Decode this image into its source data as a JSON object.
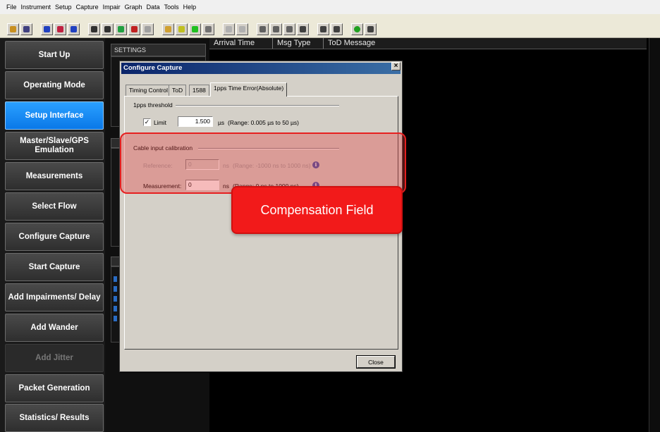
{
  "menu": [
    "File",
    "Instrument",
    "Setup",
    "Capture",
    "Impair",
    "Graph",
    "Data",
    "Tools",
    "Help"
  ],
  "sidebar": {
    "items": [
      {
        "label": "Start Up",
        "state": "normal"
      },
      {
        "label": "Operating Mode",
        "state": "normal"
      },
      {
        "label": "Setup Interface",
        "state": "active"
      },
      {
        "label": "Master/Slave/GPS Emulation",
        "state": "normal"
      },
      {
        "label": "Measurements",
        "state": "normal"
      },
      {
        "label": "Select Flow",
        "state": "normal"
      },
      {
        "label": "Configure Capture",
        "state": "normal"
      },
      {
        "label": "Start Capture",
        "state": "normal"
      },
      {
        "label": "Add Impairments/ Delay",
        "state": "normal"
      },
      {
        "label": "Add Wander",
        "state": "normal"
      },
      {
        "label": "Add Jitter",
        "state": "disabled"
      },
      {
        "label": "Packet Generation",
        "state": "normal"
      },
      {
        "label": "Statistics/ Results",
        "state": "normal"
      }
    ]
  },
  "settings_panel": {
    "title": "SETTINGS"
  },
  "message_table": {
    "columns": [
      "Arrival Time",
      "Msg Type",
      "ToD Message"
    ]
  },
  "dialog": {
    "title": "Configure Capture",
    "close_glyph": "×",
    "tabs": [
      "Timing Control",
      "ToD",
      "1588",
      "1pps Time Error(Absolute)"
    ],
    "active_tab": 3,
    "threshold_group": "1pps threshold",
    "limit": {
      "label": "Limit",
      "checked": true,
      "check_glyph": "✓",
      "value": "1.500",
      "unit": "µs",
      "range": "(Range: 0.005 µs to 50 µs)"
    },
    "cable_group": "Cable input calibration",
    "reference": {
      "label": "Reference:",
      "value": "0",
      "unit": "ns",
      "range": "(Range: -1000 ns to 1000 ns)",
      "enabled": false
    },
    "measurement": {
      "label": "Measurement:",
      "value": "0",
      "unit": "ns",
      "range": "(Range: 0 ns to 1000 ns)",
      "enabled": true
    },
    "info_glyph": "i",
    "close_button": "Close"
  },
  "annotation": {
    "callout_text": "Compensation Field",
    "color": "#f21a1a"
  },
  "toolbar_icons": [
    "open-icon",
    "save-icon",
    "connect-icon",
    "connect-icon",
    "connect-icon",
    "capture-icon",
    "capture-icon",
    "capture-icon",
    "capture-icon",
    "report-icon",
    "graph-icon",
    "capture-start-icon",
    "capture-c-icon",
    "stop-icon",
    "rewind-icon",
    "forward-icon",
    "grid-icon",
    "wave-icon",
    "list-icon",
    "block-icon",
    "play-icon",
    "stop-icon",
    "timer-icon",
    "stop-icon"
  ]
}
